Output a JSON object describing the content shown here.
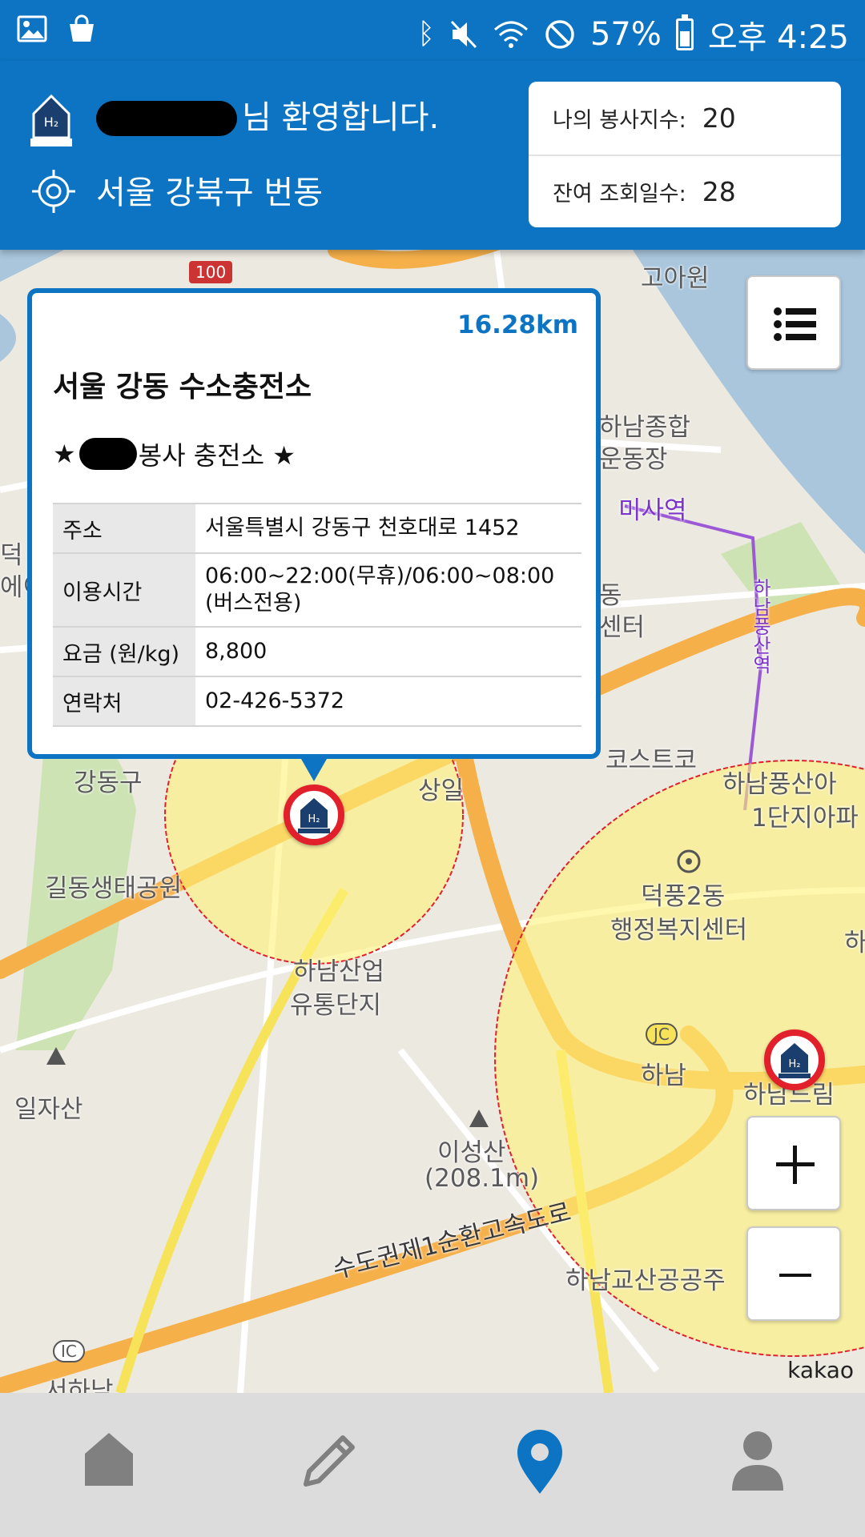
{
  "status_bar": {
    "left_icons": [
      "gallery-icon",
      "shopping-bag-icon"
    ],
    "right_icons": [
      "bluetooth-icon",
      "mute-icon",
      "wifi-icon",
      "do-not-disturb-icon",
      "battery-icon"
    ],
    "battery": "57%",
    "time": "오후 4:25"
  },
  "header": {
    "welcome_suffix": "님 환영합니다.",
    "location": "서울 강북구 번동",
    "stats": [
      {
        "label": "나의 봉사지수:",
        "value": "20"
      },
      {
        "label": "잔여 조회일수:",
        "value": "28"
      }
    ]
  },
  "map": {
    "labels": {
      "highway_shield": "100",
      "goa": "고아원",
      "hanam_stadium_1": "하남종합",
      "hanam_stadium_2": "운동장",
      "misa": "미사역",
      "line": "하남풍산역",
      "deok_1": "덕",
      "deok_2": "에이",
      "center_1": "동",
      "center_2": "센터",
      "costco": "코스트코",
      "gangdong": "강동구",
      "sangil": "상일",
      "pungsan_1": "하남풍산아",
      "pungsan_2": "1단지아파",
      "gildong": "길동생태공원",
      "deokpung_1": "덕풍2동",
      "deokpung_2": "행정복지센터",
      "ha": "하",
      "industrial_1": "하남산업",
      "industrial_2": "유통단지",
      "jc": "JC",
      "hanam": "하남",
      "hanam_dream": "하남드림",
      "iljasan": "일자산",
      "iseongsan": "이성산",
      "iseongsan_height": "(208.1m)",
      "ring_road": "수도권제1순환고속도로",
      "gyosan": "하남교산공공주",
      "ic": "IC",
      "seohanam": "서하남"
    },
    "attribution": "kakao"
  },
  "popup": {
    "distance": "16.28km",
    "name": "서울 강동 수소충전소",
    "tag_prefix": "★",
    "tag_suffix": "봉사 충전소 ★",
    "rows": [
      {
        "key": "주소",
        "value": "서울특별시 강동구 천호대로 1452"
      },
      {
        "key": "이용시간",
        "value": "06:00~22:00(무휴)/06:00~08:00(버스전용)"
      },
      {
        "key": "요금 (원/kg)",
        "value": "8,800"
      },
      {
        "key": "연락처",
        "value": "02-426-5372"
      }
    ]
  },
  "map_controls": [
    "list-icon",
    "zoom-in-icon",
    "zoom-out-icon"
  ],
  "bottom_nav": {
    "items": [
      "home-icon",
      "pencil-icon",
      "map-pin-icon",
      "person-icon"
    ],
    "active": "map-pin-icon",
    "active_color": "#0c74c2",
    "inactive_color": "#808080"
  },
  "colors": {
    "brand_blue": "#0c74c2",
    "marker_red": "#e2202b",
    "radius_fill": "#fff176"
  }
}
